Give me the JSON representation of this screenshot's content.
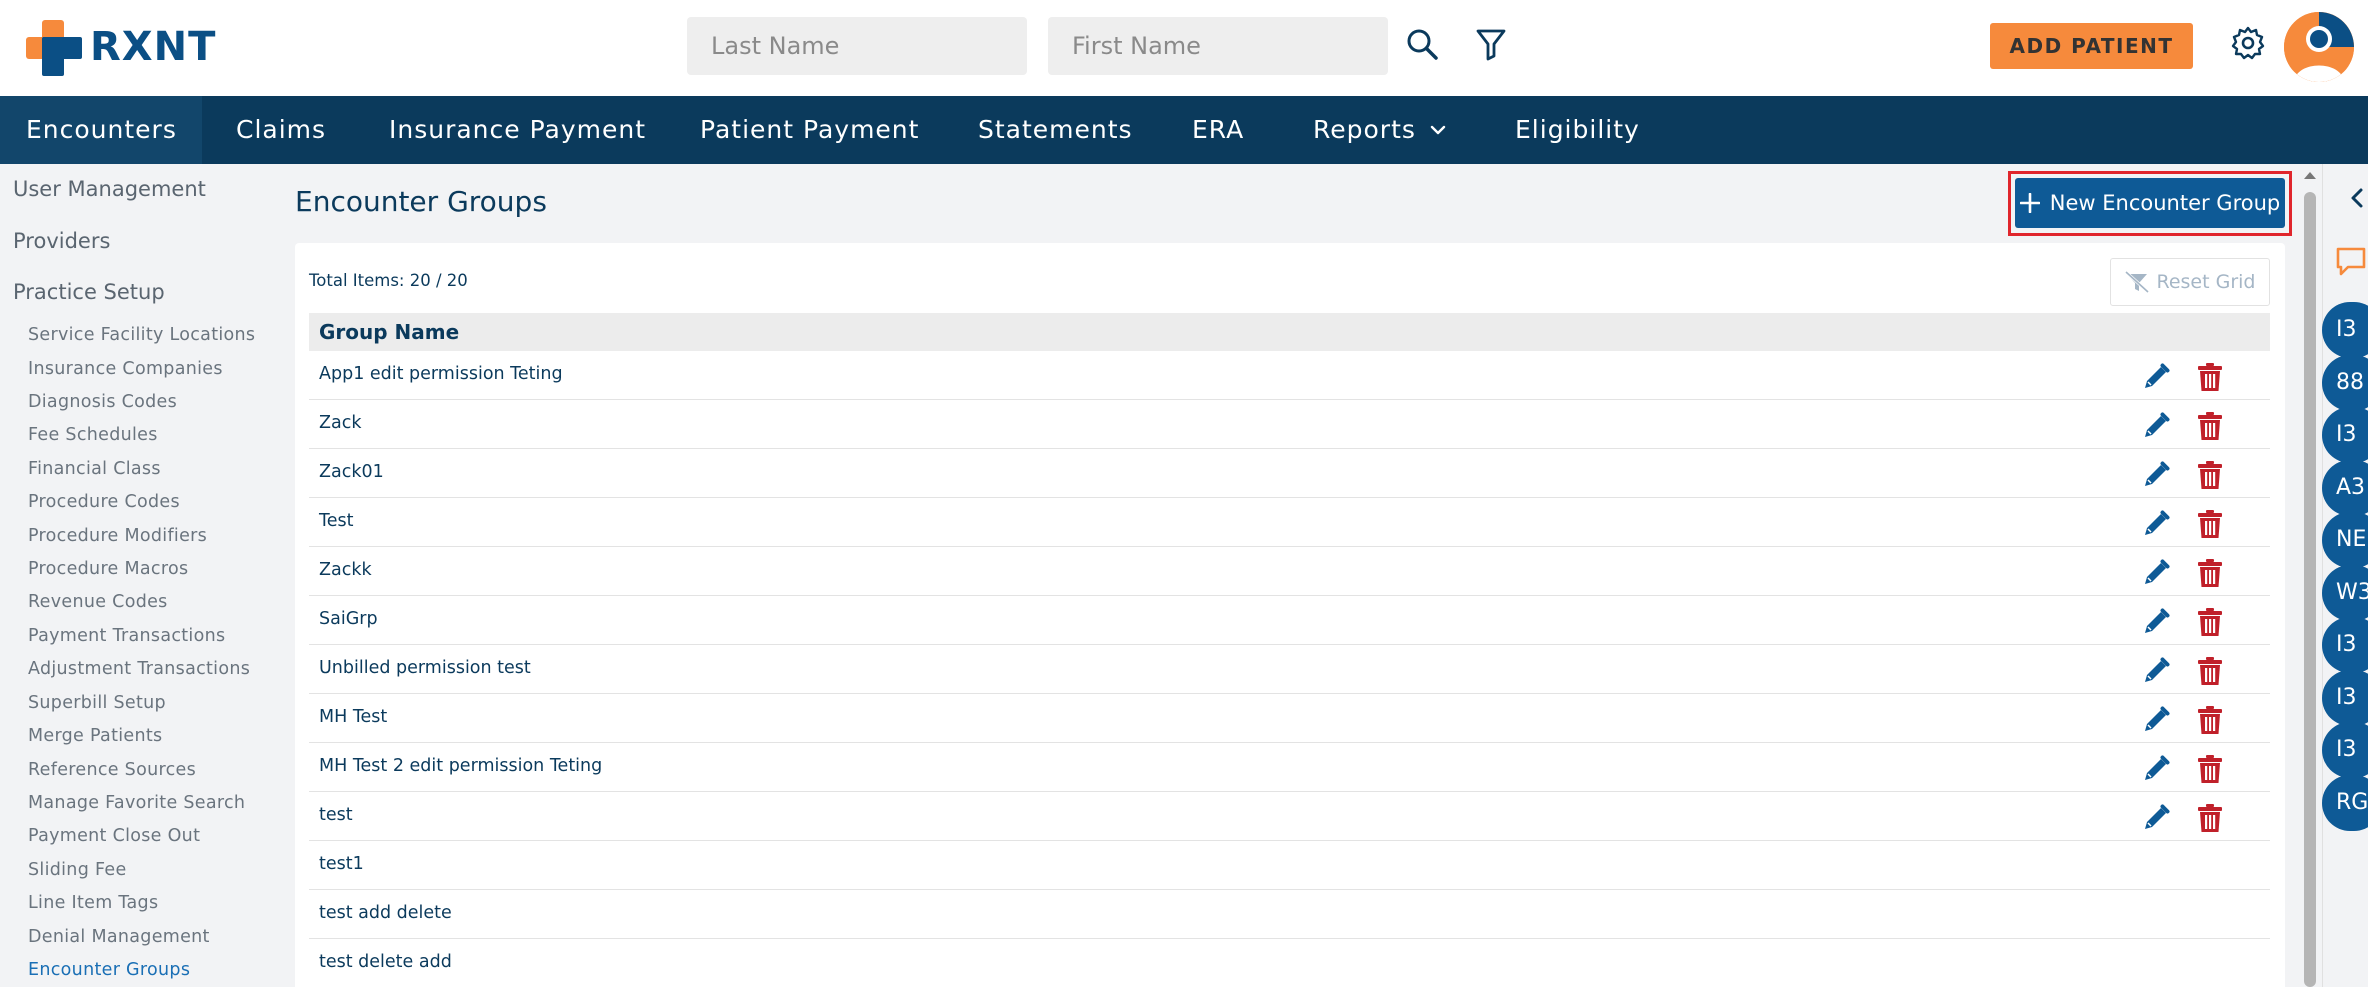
{
  "brand": {
    "name": "RXNT",
    "accent": "#f68a3c",
    "primary": "#0b3a5c"
  },
  "header": {
    "last_name_placeholder": "Last Name",
    "first_name_placeholder": "First Name",
    "add_patient_label": "ADD PATIENT",
    "icons": [
      "search-icon",
      "filter-icon",
      "gear-icon",
      "avatar"
    ]
  },
  "nav": {
    "items": [
      {
        "label": "Encounters"
      },
      {
        "label": "Claims"
      },
      {
        "label": "Insurance Payment"
      },
      {
        "label": "Patient Payment"
      },
      {
        "label": "Statements"
      },
      {
        "label": "ERA"
      },
      {
        "label": "Reports"
      },
      {
        "label": "Eligibility"
      }
    ]
  },
  "sidebar": {
    "sections": [
      {
        "label": "User Management"
      },
      {
        "label": "Providers"
      },
      {
        "label": "Practice Setup"
      }
    ],
    "items": [
      {
        "label": "Service Facility Locations"
      },
      {
        "label": "Insurance Companies"
      },
      {
        "label": "Diagnosis Codes"
      },
      {
        "label": "Fee Schedules"
      },
      {
        "label": "Financial Class"
      },
      {
        "label": "Procedure Codes"
      },
      {
        "label": "Procedure Modifiers"
      },
      {
        "label": "Procedure Macros"
      },
      {
        "label": "Revenue Codes"
      },
      {
        "label": "Payment Transactions"
      },
      {
        "label": "Adjustment Transactions"
      },
      {
        "label": "Superbill Setup"
      },
      {
        "label": "Merge Patients"
      },
      {
        "label": "Reference Sources"
      },
      {
        "label": "Manage Favorite Search"
      },
      {
        "label": "Payment Close Out"
      },
      {
        "label": "Sliding Fee"
      },
      {
        "label": "Line Item Tags"
      },
      {
        "label": "Denial Management"
      },
      {
        "label": "Encounter Groups"
      }
    ]
  },
  "main": {
    "title": "Encounter Groups",
    "new_group_label": "New Encounter Group",
    "total_items": "Total Items: 20 / 20",
    "reset_grid_label": "Reset Grid",
    "column_header": "Group Name",
    "rows": [
      {
        "name": "App1 edit permission Teting",
        "actions": true
      },
      {
        "name": "Zack",
        "actions": true
      },
      {
        "name": "Zack01",
        "actions": true
      },
      {
        "name": "Test",
        "actions": true
      },
      {
        "name": "Zackk",
        "actions": true
      },
      {
        "name": "SaiGrp",
        "actions": true
      },
      {
        "name": "Unbilled permission test",
        "actions": true
      },
      {
        "name": "MH Test",
        "actions": true
      },
      {
        "name": "MH Test 2 edit permission Teting",
        "actions": true
      },
      {
        "name": "test",
        "actions": true
      },
      {
        "name": "test1",
        "actions": false
      },
      {
        "name": "test add delete",
        "actions": false
      },
      {
        "name": "test delete add",
        "actions": false
      }
    ]
  },
  "rail": {
    "bubbles": [
      {
        "label": "I3"
      },
      {
        "label": "88"
      },
      {
        "label": "I3"
      },
      {
        "label": "A3"
      },
      {
        "label": "NE"
      },
      {
        "label": "W3"
      },
      {
        "label": "I3"
      },
      {
        "label": "I3"
      },
      {
        "label": "I3"
      },
      {
        "label": "RG"
      }
    ]
  }
}
